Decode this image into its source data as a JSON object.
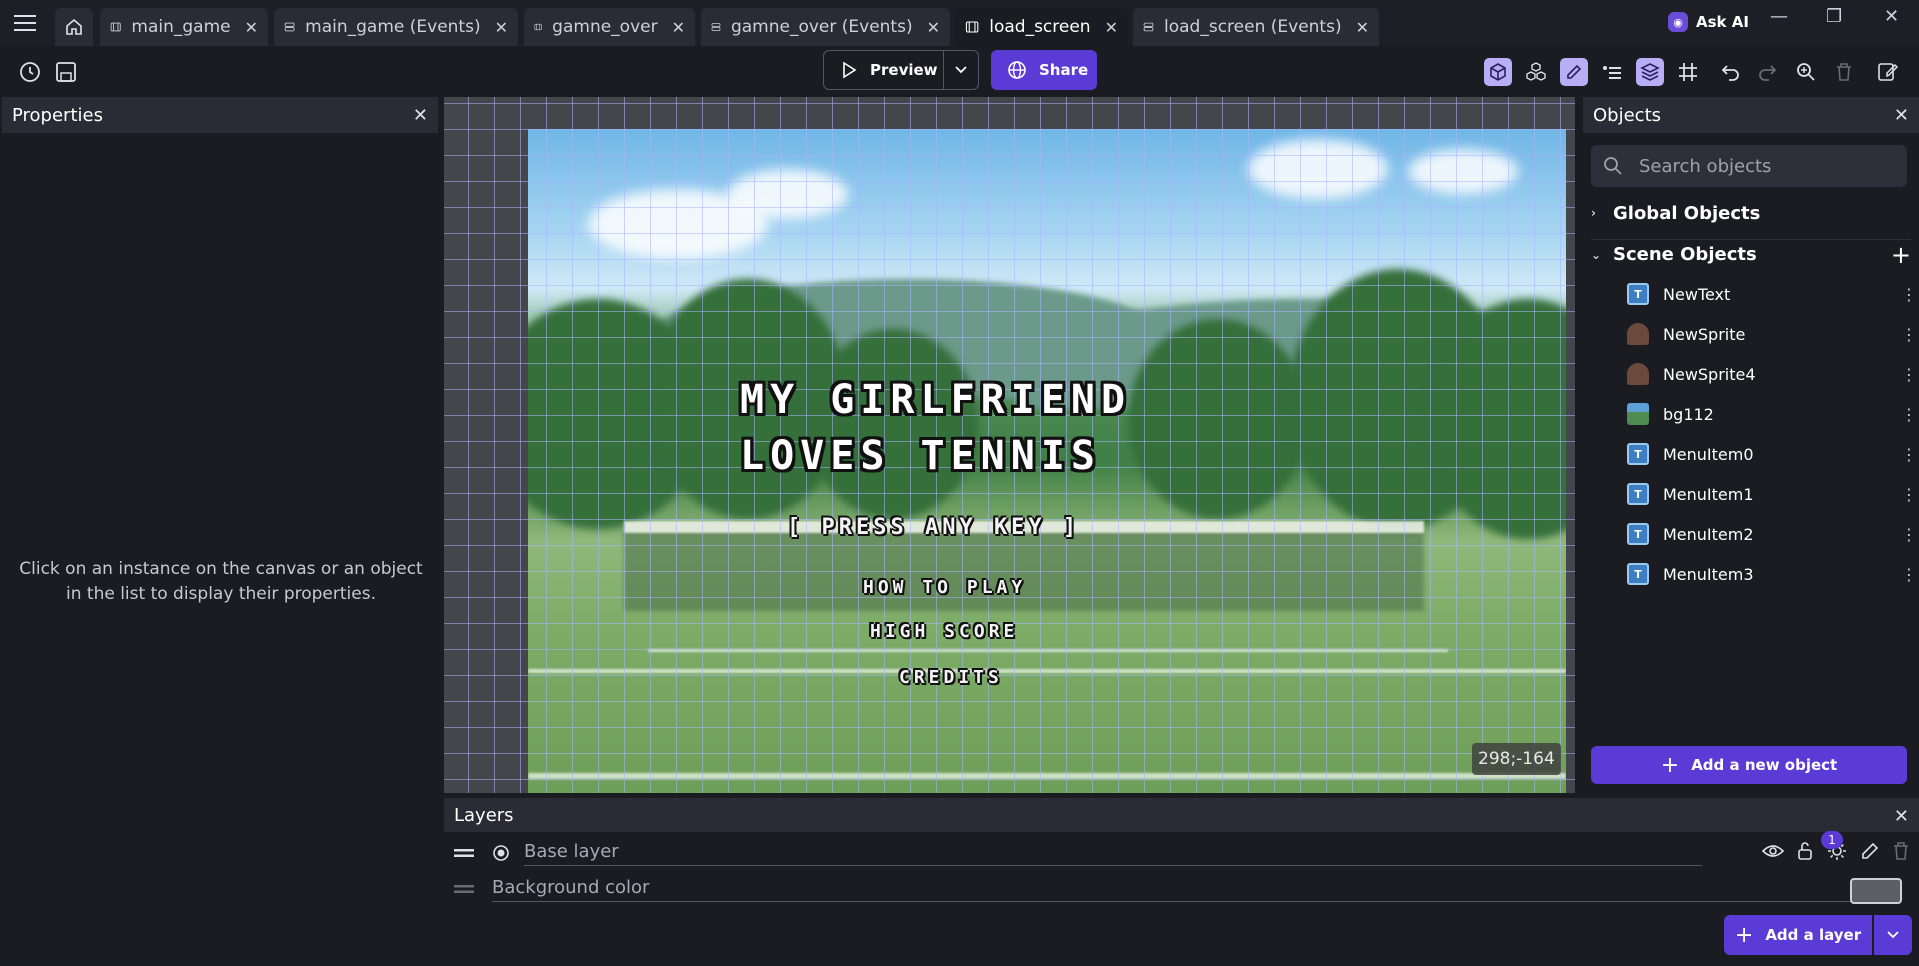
{
  "tabs": [
    {
      "label": "main_game",
      "icon": "scene-icon",
      "active": false
    },
    {
      "label": "main_game (Events)",
      "icon": "events-icon",
      "active": false
    },
    {
      "label": "gamne_over",
      "icon": "scene-icon",
      "active": false
    },
    {
      "label": "gamne_over (Events)",
      "icon": "events-icon",
      "active": false
    },
    {
      "label": "load_screen",
      "icon": "scene-icon",
      "active": true
    },
    {
      "label": "load_screen (Events)",
      "icon": "events-icon",
      "active": false
    }
  ],
  "ask_ai": {
    "label": "Ask AI"
  },
  "toolbar": {
    "preview_label": "Preview",
    "share_label": "Share"
  },
  "properties": {
    "title": "Properties",
    "hint": "Click on an instance on the canvas or an object in the list to display their properties."
  },
  "scene": {
    "title_line1": "MY GIRLFRIEND",
    "title_line2": "LOVES TENNIS",
    "press_key": "[ PRESS ANY KEY ]",
    "menu_items": [
      "HOW TO PLAY",
      "HIGH SCORE",
      "CREDITS"
    ],
    "cursor_coords": "298;-164"
  },
  "objects_panel": {
    "title": "Objects",
    "search_placeholder": "Search objects",
    "global_group": "Global Objects",
    "scene_group": "Scene Objects",
    "items": [
      {
        "name": "NewText",
        "type": "text"
      },
      {
        "name": "NewSprite",
        "type": "sprite"
      },
      {
        "name": "NewSprite4",
        "type": "sprite"
      },
      {
        "name": "bg112",
        "type": "bg"
      },
      {
        "name": "MenuItem0",
        "type": "text"
      },
      {
        "name": "MenuItem1",
        "type": "text"
      },
      {
        "name": "MenuItem2",
        "type": "text"
      },
      {
        "name": "MenuItem3",
        "type": "text"
      }
    ],
    "add_label": "Add a new object"
  },
  "layers_panel": {
    "title": "Layers",
    "base_layer": "Base layer",
    "background_color": "Background color",
    "lights_badge": "1",
    "add_label": "Add a layer"
  },
  "colors": {
    "accent": "#5b3bd5",
    "panel_bg": "#1b1b22",
    "header_bg": "#2b2b36"
  }
}
